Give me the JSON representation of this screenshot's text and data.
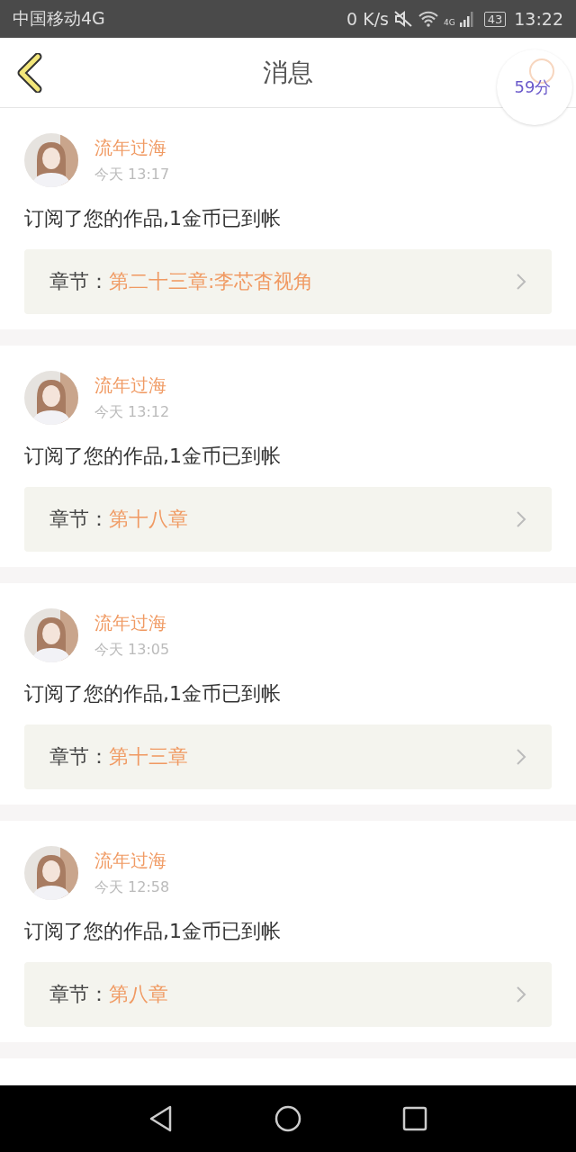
{
  "status_bar": {
    "carrier": "中国移动4G",
    "speed": "0 K/s",
    "network": "4G",
    "battery": "43",
    "time": "13:22"
  },
  "header": {
    "title": "消息",
    "badge": "59分"
  },
  "messages": [
    {
      "name": "流年过海",
      "time": "今天 13:17",
      "text": "订阅了您的作品,1金币已到帐",
      "chapter_label": "章节：",
      "chapter": "第二十三章:李芯杳视角"
    },
    {
      "name": "流年过海",
      "time": "今天 13:12",
      "text": "订阅了您的作品,1金币已到帐",
      "chapter_label": "章节：",
      "chapter": "第十八章"
    },
    {
      "name": "流年过海",
      "time": "今天 13:05",
      "text": "订阅了您的作品,1金币已到帐",
      "chapter_label": "章节：",
      "chapter": "第十三章"
    },
    {
      "name": "流年过海",
      "time": "今天 12:58",
      "text": "订阅了您的作品,1金币已到帐",
      "chapter_label": "章节：",
      "chapter": "第八章"
    }
  ]
}
